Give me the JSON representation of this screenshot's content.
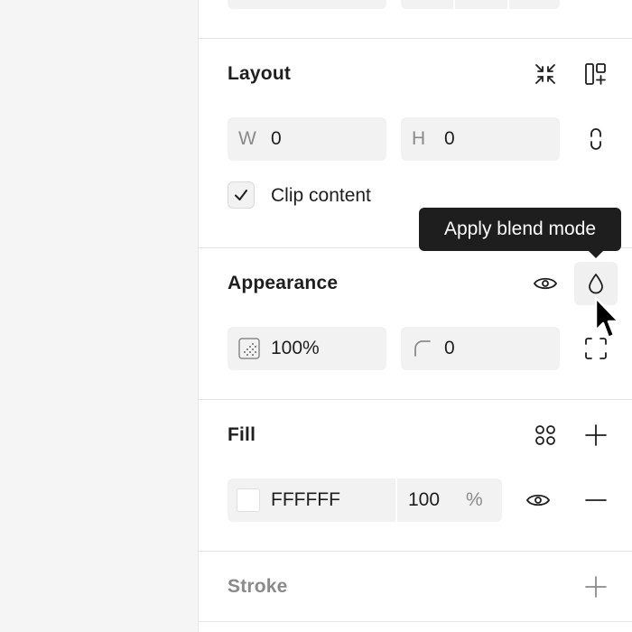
{
  "layout": {
    "title": "Layout",
    "width_prefix": "W",
    "width_value": "0",
    "height_prefix": "H",
    "height_value": "0",
    "clip_label": "Clip content",
    "clip_checked": true
  },
  "tooltip": {
    "text": "Apply blend mode"
  },
  "appearance": {
    "title": "Appearance",
    "opacity_value": "100%",
    "radius_value": "0"
  },
  "fill": {
    "title": "Fill",
    "hex_value": "FFFFFF",
    "opacity_value": "100",
    "opacity_unit": "%",
    "swatch_color": "#FFFFFF"
  },
  "stroke": {
    "title": "Stroke"
  },
  "icons": {
    "collapse": "collapse-arrows-icon",
    "auto_layout_add": "auto-layout-add-icon",
    "constrain": "link-proportions-icon",
    "visibility": "eye-icon",
    "blend": "drop-icon",
    "opacity": "opacity-grid-icon",
    "corner": "corner-radius-icon",
    "individual_corners": "corners-icon",
    "styles": "four-dots-icon",
    "add": "plus-icon",
    "remove": "minus-icon",
    "cursor": "pointer-cursor-icon"
  },
  "colors": {
    "panel_bg": "#FFFFFF",
    "canvas_bg": "#F5F5F5",
    "field_bg": "#F2F2F2",
    "tooltip_bg": "#1E1E1E",
    "text": "#1E1E1E",
    "muted": "#8A8A8A"
  }
}
